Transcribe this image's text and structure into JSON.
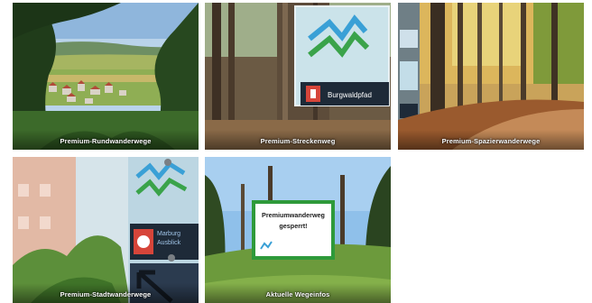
{
  "tiles": [
    {
      "title": "Premium-Rundwanderwege"
    },
    {
      "title": "Premium-Streckenweg",
      "sign_text": "Burgwaldpfad"
    },
    {
      "title": "Premium-Spazierwanderwege"
    },
    {
      "title": "Premium-Stadtwanderwege",
      "sign_text_1": "Marburg",
      "sign_text_2": "Ausblick"
    },
    {
      "title": "Aktuelle Wegeinfos",
      "notice_line_1": "Premiumwanderweg",
      "notice_line_2": "gesperrt!"
    }
  ],
  "colors": {
    "sky": "#a9c9e8",
    "forest": "#3f6b2a",
    "sign_green": "#3aa34a",
    "sign_blue": "#3aa0d6",
    "sign_dark": "#1e2a38",
    "autumn": "#d89a3a"
  }
}
